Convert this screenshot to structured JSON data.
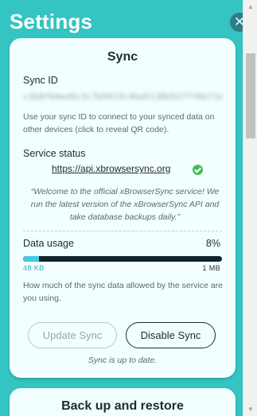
{
  "header": {
    "title": "Settings",
    "close_icon": "close-icon"
  },
  "sync_card": {
    "title": "Sync",
    "sync_id": {
      "label": "Sync ID",
      "value": "c3b8f64ed9c3c7b9413c4ba5138b527ff6b71a9f3",
      "help": "Use your sync ID to connect to your synced data on other devices (click to reveal QR code)."
    },
    "service": {
      "label": "Service status",
      "url": "https://api.xbrowsersync.org",
      "status_icon": "check-circle-icon",
      "status_color": "#3fbf5a",
      "message": "“Welcome to the official xBrowserSync service! We run the latest version of the xBrowserSync API and take database backups daily.”"
    },
    "usage": {
      "label": "Data usage",
      "percent_label": "8%",
      "percent": 8,
      "min_label": "48 KB",
      "max_label": "1 MB",
      "help": "How much of the sync data allowed by the service are you using.",
      "bar_color": "#10242e",
      "fill_color": "#47c7e6"
    },
    "buttons": {
      "update": "Update Sync",
      "disable": "Disable Sync"
    },
    "status": "Sync is up to date."
  },
  "backup_card": {
    "title": "Back up and restore"
  },
  "colors": {
    "background": "#34c4c1",
    "card": "#f2fffe",
    "close_button": "#2d7f86",
    "text_dark": "#1d2c30"
  }
}
